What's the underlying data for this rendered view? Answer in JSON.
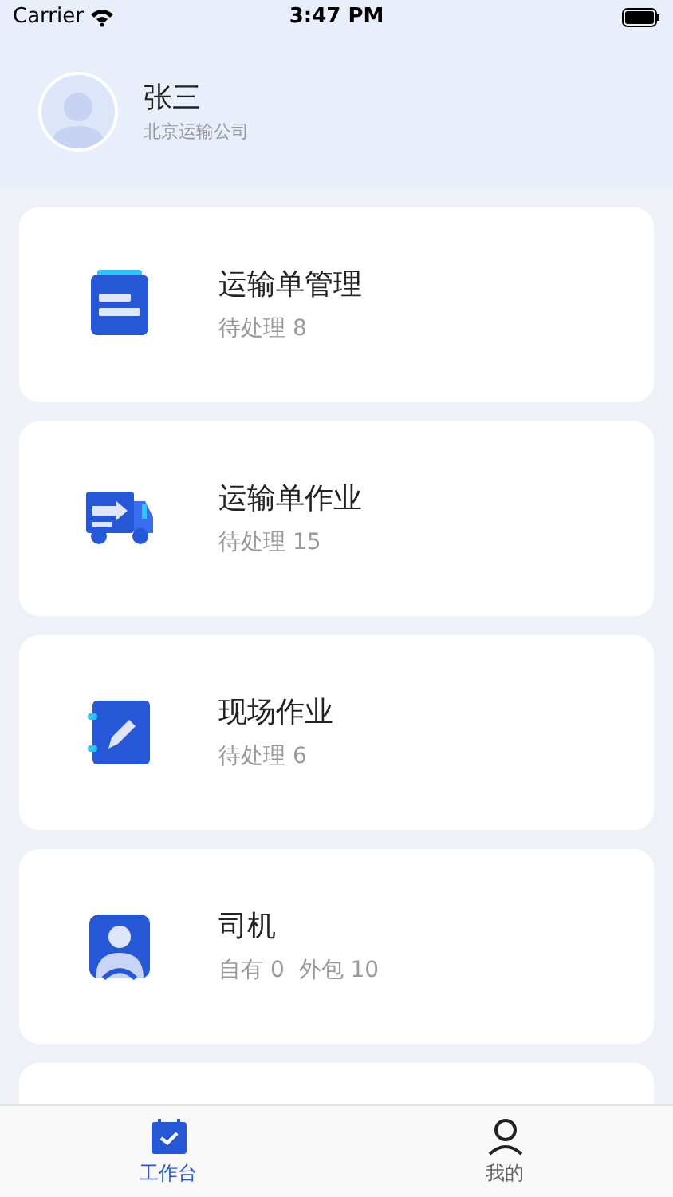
{
  "status_bar": {
    "carrier": "Carrier",
    "time": "3:47 PM"
  },
  "profile": {
    "name": "张三",
    "company": "北京运输公司"
  },
  "cards": [
    {
      "kind": "document",
      "title": "运输单管理",
      "subtitle": "待处理 8"
    },
    {
      "kind": "truck",
      "title": "运输单作业",
      "subtitle": "待处理 15"
    },
    {
      "kind": "notebook",
      "title": "现场作业",
      "subtitle": "待处理 6"
    },
    {
      "kind": "driver",
      "title": "司机",
      "subtitle": "自有 0  外包 10"
    }
  ],
  "tab_bar": [
    {
      "kind": "workbench",
      "label": "工作台",
      "selected": true
    },
    {
      "kind": "profile",
      "label": "我的",
      "selected": false
    }
  ]
}
